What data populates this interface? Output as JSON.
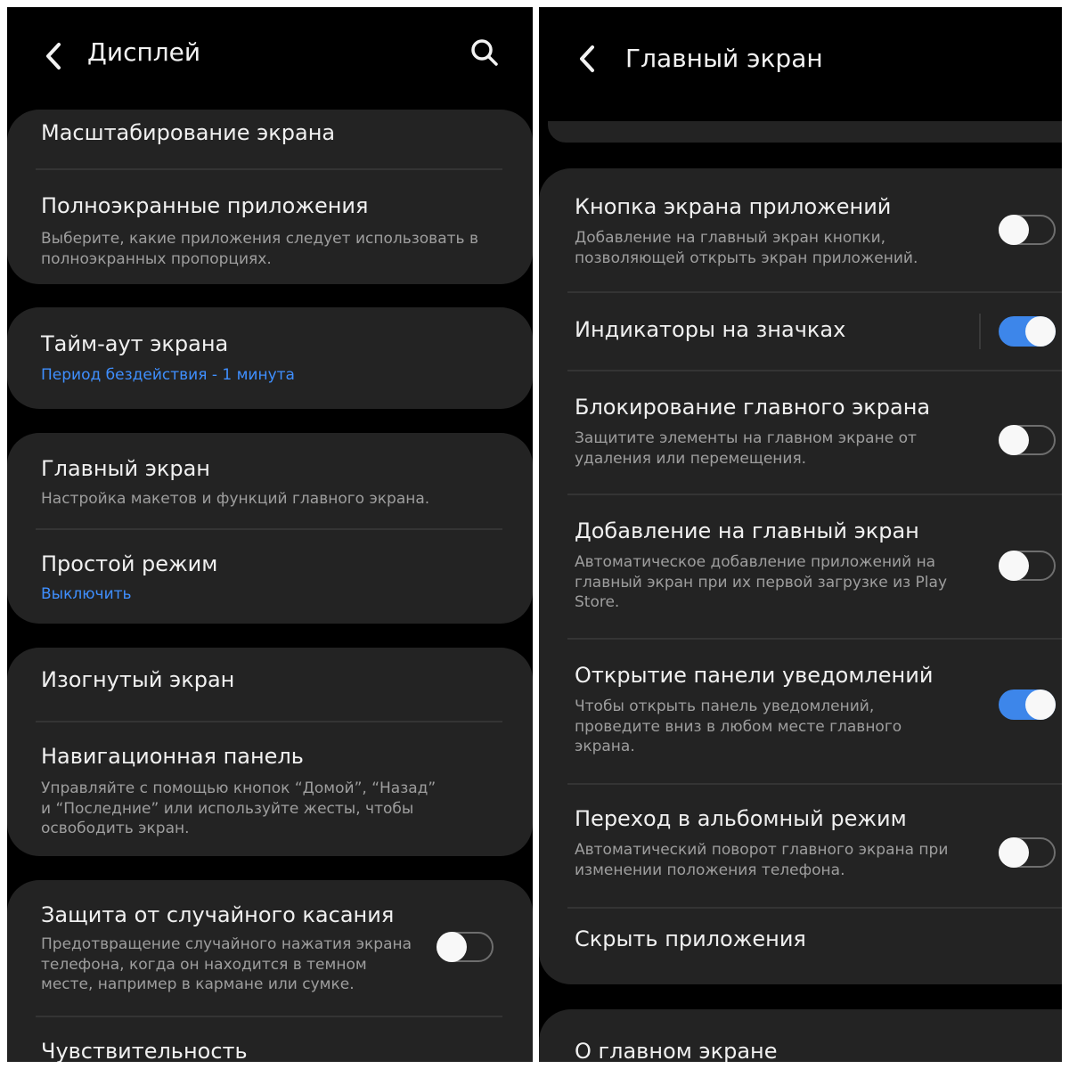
{
  "left": {
    "header": {
      "title": "Дисплей",
      "back_icon": "chevron-left-icon",
      "search_icon": "search-icon"
    },
    "items": [
      {
        "title": "Масштабирование экрана"
      },
      {
        "title": "Полноэкранные приложения",
        "subtitle": "Выберите, какие приложения следует использовать в полноэкранных пропорциях."
      },
      {
        "title": "Тайм-аут экрана",
        "subtitle": "Период бездействия - 1 минута"
      },
      {
        "title": "Главный экран",
        "subtitle": "Настройка макетов и функций главного экрана."
      },
      {
        "title": "Простой режим",
        "subtitle": "Выключить"
      },
      {
        "title": "Изогнутый экран"
      },
      {
        "title": "Навигационная панель",
        "subtitle": "Управляйте с помощью кнопок “Домой”, “Назад” и “Последние” или используйте жесты, чтобы освободить экран."
      },
      {
        "title": "Защита от случайного касания",
        "subtitle": "Предотвращение случайного нажатия экрана телефона, когда он находится в темном месте, например в кармане или сумке.",
        "toggle": false
      },
      {
        "title": "Чувствительность"
      }
    ]
  },
  "right": {
    "header": {
      "title": "Главный экран",
      "back_icon": "chevron-left-icon"
    },
    "items": [
      {
        "title": "Кнопка экрана приложений",
        "subtitle": "Добавление на главный экран кнопки, позволяющей открыть экран приложений.",
        "toggle": false
      },
      {
        "title": "Индикаторы на значках",
        "toggle": true
      },
      {
        "title": "Блокирование главного экрана",
        "subtitle": "Защитите элементы на главном экране от удаления или перемещения.",
        "toggle": false
      },
      {
        "title": "Добавление на главный экран",
        "subtitle": "Автоматическое добавление приложений на главный экран при их первой загрузке из Play Store.",
        "toggle": false
      },
      {
        "title": "Открытие панели уведомлений",
        "subtitle": "Чтобы открыть панель уведомлений, проведите вниз в любом месте главного экрана.",
        "toggle": true
      },
      {
        "title": "Переход в альбомный режим",
        "subtitle": "Автоматический поворот главного экрана при изменении положения телефона.",
        "toggle": false
      },
      {
        "title": "Скрыть приложения"
      },
      {
        "title": "О главном экране"
      }
    ]
  },
  "colors": {
    "background": "#000000",
    "card": "#232323",
    "accent": "#3f8fff",
    "toggle_on": "#3d86ea"
  }
}
